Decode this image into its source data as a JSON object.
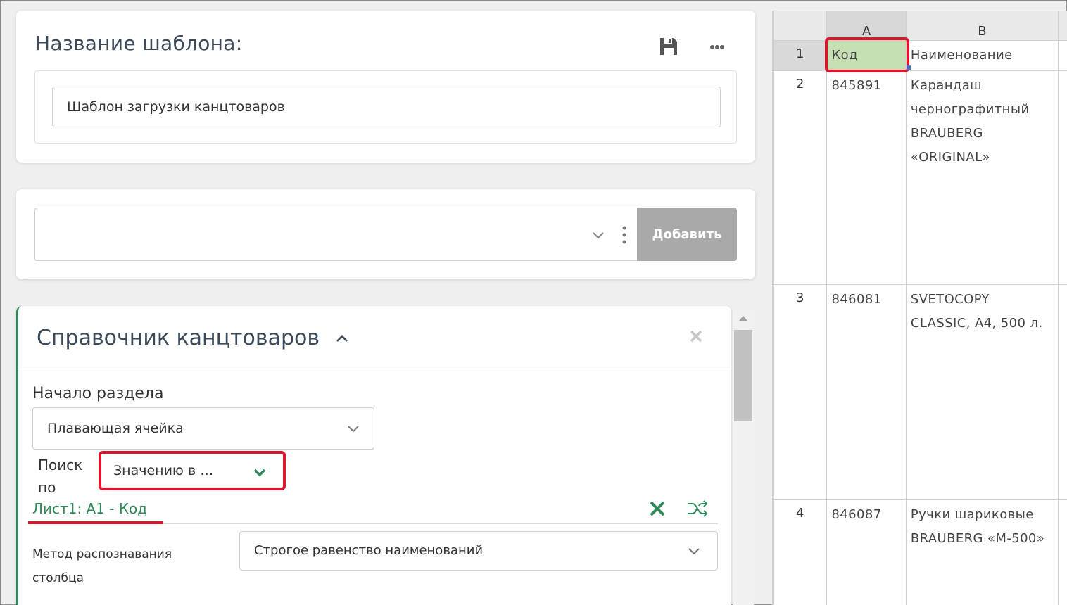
{
  "template_card": {
    "title": "Название шаблона:",
    "name_value": "Шаблон загрузки канцтоваров"
  },
  "add_card": {
    "select_value": "",
    "add_label": "Добавить"
  },
  "section": {
    "title": "Справочник канцтоваров",
    "start_label": "Начало раздела",
    "start_value": "Плавающая ячейка",
    "search_label": "Поиск по",
    "search_value": "Значению в …",
    "reference_link": "Лист1: A1 - Код",
    "method_label": "Метод распознавания столбца",
    "method_value": "Строгое равенство наименований"
  },
  "sheet": {
    "columns": [
      "A",
      "B"
    ],
    "rows": [
      {
        "num": "1",
        "a": "Код",
        "b": "Наименование"
      },
      {
        "num": "2",
        "a": "845891",
        "b": "Карандаш чернографитный BRAUBERG «ORIGINAL»"
      },
      {
        "num": "3",
        "a": "846081",
        "b": "SVETOCOPY CLASSIC, A4, 500 л."
      },
      {
        "num": "4",
        "a": "846087",
        "b": "Ручки шариковые BRAUBERG «M-500»"
      }
    ]
  },
  "colors": {
    "accent_green": "#2e8b57",
    "highlight_red": "#e0142d",
    "selected_cell": "#c6e0b4",
    "button_gray": "#a9a9a9"
  },
  "icons": [
    "save-icon",
    "more-icon",
    "chevron-down-icon",
    "vertical-dots-icon",
    "chevron-up-icon",
    "close-icon",
    "x-icon",
    "shuffle-icon",
    "scroll-up-arrow-icon"
  ]
}
